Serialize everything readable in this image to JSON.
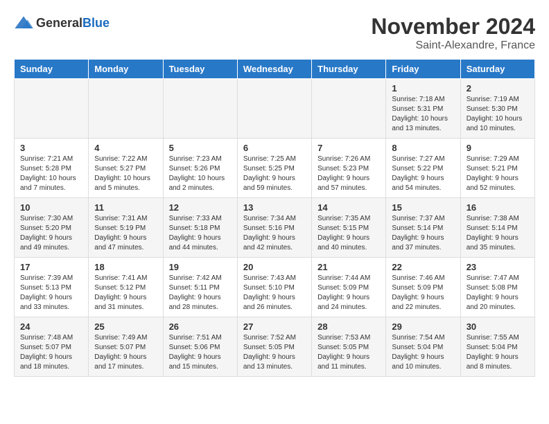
{
  "logo": {
    "line1": "General",
    "line2": "Blue"
  },
  "title": "November 2024",
  "subtitle": "Saint-Alexandre, France",
  "weekdays": [
    "Sunday",
    "Monday",
    "Tuesday",
    "Wednesday",
    "Thursday",
    "Friday",
    "Saturday"
  ],
  "weeks": [
    [
      {
        "day": "",
        "info": ""
      },
      {
        "day": "",
        "info": ""
      },
      {
        "day": "",
        "info": ""
      },
      {
        "day": "",
        "info": ""
      },
      {
        "day": "",
        "info": ""
      },
      {
        "day": "1",
        "info": "Sunrise: 7:18 AM\nSunset: 5:31 PM\nDaylight: 10 hours\nand 13 minutes."
      },
      {
        "day": "2",
        "info": "Sunrise: 7:19 AM\nSunset: 5:30 PM\nDaylight: 10 hours\nand 10 minutes."
      }
    ],
    [
      {
        "day": "3",
        "info": "Sunrise: 7:21 AM\nSunset: 5:28 PM\nDaylight: 10 hours\nand 7 minutes."
      },
      {
        "day": "4",
        "info": "Sunrise: 7:22 AM\nSunset: 5:27 PM\nDaylight: 10 hours\nand 5 minutes."
      },
      {
        "day": "5",
        "info": "Sunrise: 7:23 AM\nSunset: 5:26 PM\nDaylight: 10 hours\nand 2 minutes."
      },
      {
        "day": "6",
        "info": "Sunrise: 7:25 AM\nSunset: 5:25 PM\nDaylight: 9 hours\nand 59 minutes."
      },
      {
        "day": "7",
        "info": "Sunrise: 7:26 AM\nSunset: 5:23 PM\nDaylight: 9 hours\nand 57 minutes."
      },
      {
        "day": "8",
        "info": "Sunrise: 7:27 AM\nSunset: 5:22 PM\nDaylight: 9 hours\nand 54 minutes."
      },
      {
        "day": "9",
        "info": "Sunrise: 7:29 AM\nSunset: 5:21 PM\nDaylight: 9 hours\nand 52 minutes."
      }
    ],
    [
      {
        "day": "10",
        "info": "Sunrise: 7:30 AM\nSunset: 5:20 PM\nDaylight: 9 hours\nand 49 minutes."
      },
      {
        "day": "11",
        "info": "Sunrise: 7:31 AM\nSunset: 5:19 PM\nDaylight: 9 hours\nand 47 minutes."
      },
      {
        "day": "12",
        "info": "Sunrise: 7:33 AM\nSunset: 5:18 PM\nDaylight: 9 hours\nand 44 minutes."
      },
      {
        "day": "13",
        "info": "Sunrise: 7:34 AM\nSunset: 5:16 PM\nDaylight: 9 hours\nand 42 minutes."
      },
      {
        "day": "14",
        "info": "Sunrise: 7:35 AM\nSunset: 5:15 PM\nDaylight: 9 hours\nand 40 minutes."
      },
      {
        "day": "15",
        "info": "Sunrise: 7:37 AM\nSunset: 5:14 PM\nDaylight: 9 hours\nand 37 minutes."
      },
      {
        "day": "16",
        "info": "Sunrise: 7:38 AM\nSunset: 5:14 PM\nDaylight: 9 hours\nand 35 minutes."
      }
    ],
    [
      {
        "day": "17",
        "info": "Sunrise: 7:39 AM\nSunset: 5:13 PM\nDaylight: 9 hours\nand 33 minutes."
      },
      {
        "day": "18",
        "info": "Sunrise: 7:41 AM\nSunset: 5:12 PM\nDaylight: 9 hours\nand 31 minutes."
      },
      {
        "day": "19",
        "info": "Sunrise: 7:42 AM\nSunset: 5:11 PM\nDaylight: 9 hours\nand 28 minutes."
      },
      {
        "day": "20",
        "info": "Sunrise: 7:43 AM\nSunset: 5:10 PM\nDaylight: 9 hours\nand 26 minutes."
      },
      {
        "day": "21",
        "info": "Sunrise: 7:44 AM\nSunset: 5:09 PM\nDaylight: 9 hours\nand 24 minutes."
      },
      {
        "day": "22",
        "info": "Sunrise: 7:46 AM\nSunset: 5:09 PM\nDaylight: 9 hours\nand 22 minutes."
      },
      {
        "day": "23",
        "info": "Sunrise: 7:47 AM\nSunset: 5:08 PM\nDaylight: 9 hours\nand 20 minutes."
      }
    ],
    [
      {
        "day": "24",
        "info": "Sunrise: 7:48 AM\nSunset: 5:07 PM\nDaylight: 9 hours\nand 18 minutes."
      },
      {
        "day": "25",
        "info": "Sunrise: 7:49 AM\nSunset: 5:07 PM\nDaylight: 9 hours\nand 17 minutes."
      },
      {
        "day": "26",
        "info": "Sunrise: 7:51 AM\nSunset: 5:06 PM\nDaylight: 9 hours\nand 15 minutes."
      },
      {
        "day": "27",
        "info": "Sunrise: 7:52 AM\nSunset: 5:05 PM\nDaylight: 9 hours\nand 13 minutes."
      },
      {
        "day": "28",
        "info": "Sunrise: 7:53 AM\nSunset: 5:05 PM\nDaylight: 9 hours\nand 11 minutes."
      },
      {
        "day": "29",
        "info": "Sunrise: 7:54 AM\nSunset: 5:04 PM\nDaylight: 9 hours\nand 10 minutes."
      },
      {
        "day": "30",
        "info": "Sunrise: 7:55 AM\nSunset: 5:04 PM\nDaylight: 9 hours\nand 8 minutes."
      }
    ]
  ]
}
